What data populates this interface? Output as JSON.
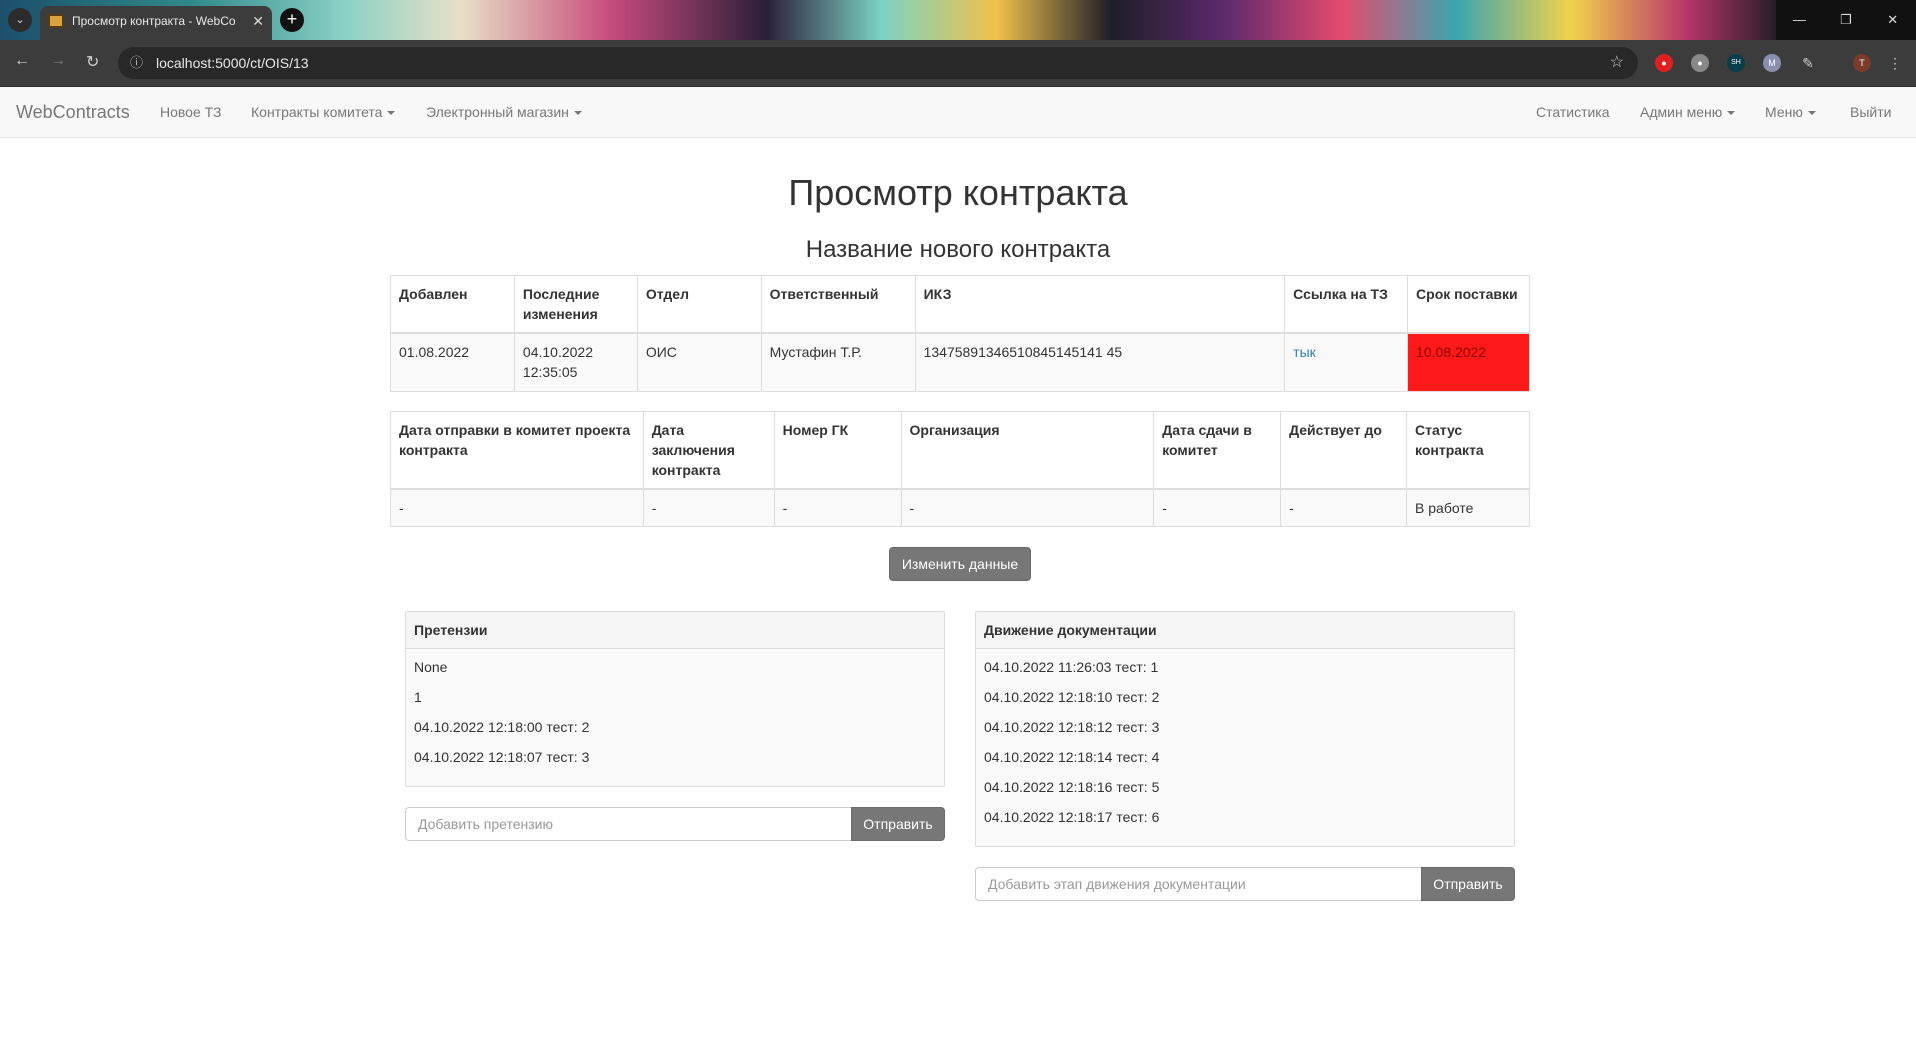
{
  "browser": {
    "tab_title": "Просмотр контракта - WebCo",
    "url": "localhost:5000/ct/OIS/13",
    "profile_initial": "T"
  },
  "navbar": {
    "brand": "WebContracts",
    "new_tz": "Новое ТЗ",
    "committee_contracts": "Контракты комитета",
    "eshop": "Электронный магазин",
    "stats": "Статистика",
    "admin_menu": "Админ меню",
    "menu": "Меню",
    "logout": "Выйти"
  },
  "page": {
    "title": "Просмотр контракта",
    "contract_name": "Название нового контракта"
  },
  "table1": {
    "headers": [
      "Добавлен",
      "Последние изменения",
      "Отдел",
      "Ответственный",
      "ИКЗ",
      "Ссылка на ТЗ",
      "Срок поставки"
    ],
    "row": {
      "added": "01.08.2022",
      "last_modified": "04.10.2022 12:35:05",
      "department": "ОИС",
      "responsible": "Мустафин Т.Р.",
      "ikz": "13475891346510845145141 45",
      "tz_link": "тык",
      "delivery_deadline": "10.08.2022"
    },
    "deadline_color": "#ff1a1a"
  },
  "table2": {
    "headers": [
      "Дата отправки в комитет проекта контракта",
      "Дата заключения контракта",
      "Номер ГК",
      "Организация",
      "Дата сдачи в комитет",
      "Действует до",
      "Статус контракта"
    ],
    "row": [
      "-",
      "-",
      "-",
      "-",
      "-",
      "-",
      "В работе"
    ]
  },
  "edit_button": "Изменить данные",
  "claims": {
    "title": "Претензии",
    "items": [
      "None",
      "1",
      "04.10.2022 12:18:00 тест: 2",
      "04.10.2022 12:18:07 тест: 3"
    ],
    "input_placeholder": "Добавить претензию",
    "submit": "Отправить"
  },
  "docs": {
    "title": "Движение документации",
    "items": [
      "04.10.2022 11:26:03 тест: 1",
      "04.10.2022 12:18:10 тест: 2",
      "04.10.2022 12:18:12 тест: 3",
      "04.10.2022 12:18:14 тест: 4",
      "04.10.2022 12:18:16 тест: 5",
      "04.10.2022 12:18:17 тест: 6"
    ],
    "input_placeholder": "Добавить этап движения документации",
    "submit": "Отправить"
  }
}
